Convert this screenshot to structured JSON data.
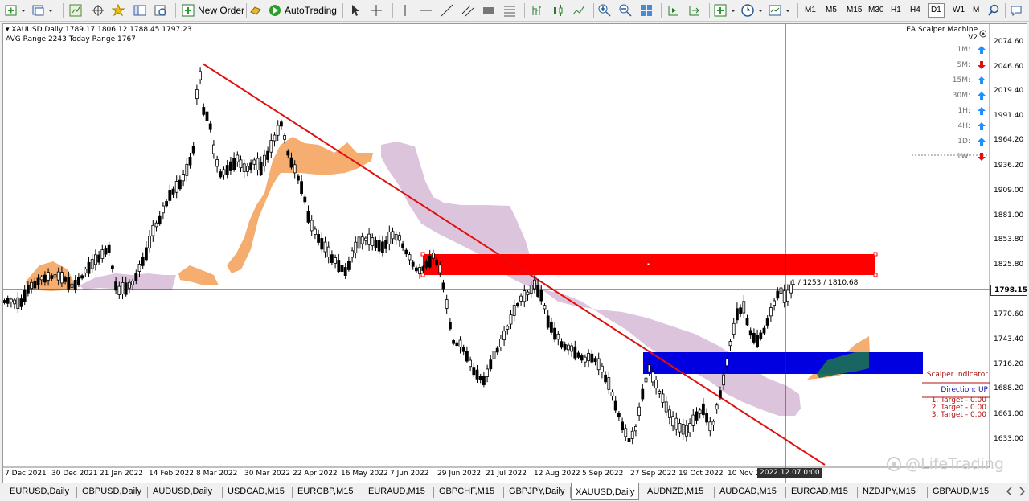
{
  "toolbar": {
    "new_order_label": "New Order",
    "autotrading_label": "AutoTrading",
    "timeframes": [
      "M1",
      "M5",
      "M15",
      "M30",
      "H1",
      "H4",
      "D1",
      "W1",
      "M"
    ],
    "active_timeframe": "D1"
  },
  "chart_header": {
    "symbol_line": "XAUUSD,Daily  1789.17 1806.12 1788.45 1797.23",
    "range_line": "AVG Range 2243   Today Range 1767"
  },
  "ea_panel": {
    "title": "EA Scalper Machine V2",
    "rows": [
      {
        "tf": "1M:",
        "dir": "up"
      },
      {
        "tf": "5M:",
        "dir": "down"
      },
      {
        "tf": "15M:",
        "dir": "up"
      },
      {
        "tf": "30M:",
        "dir": "up"
      },
      {
        "tf": "1H:",
        "dir": "up"
      },
      {
        "tf": "4H:",
        "dir": "up"
      },
      {
        "tf": "1D:",
        "dir": "up"
      },
      {
        "tf": "1W:",
        "dir": "down"
      }
    ]
  },
  "scalper_box": {
    "title": "Scalper Indicator",
    "direction": "Direction: UP",
    "targets": [
      "1. Target - 0.00",
      "2. Target - 0.00",
      "3. Target - 0.00"
    ]
  },
  "price_axis": {
    "ticks": [
      "2074.60",
      "2046.60",
      "2019.40",
      "1991.40",
      "1964.20",
      "1936.20",
      "1909.00",
      "1881.00",
      "1853.80",
      "1825.80",
      "1798.15",
      "1770.60",
      "1743.40",
      "1716.20",
      "1688.20",
      "1661.00",
      "1633.00"
    ],
    "current_price": "1798.15"
  },
  "time_axis": {
    "ticks": [
      "7 Dec 2021",
      "30 Dec 2021",
      "21 Jan 2022",
      "14 Feb 2022",
      "8 Mar 2022",
      "30 Mar 2022",
      "22 Apr 2022",
      "16 May 2022",
      "7 Jun 2022",
      "29 Jun 2022",
      "21 Jul 2022",
      "12 Aug 2022",
      "5 Sep 2022",
      "27 Sep 2022",
      "19 Oct 2022",
      "10 Nov 2"
    ],
    "crosshair_label": "2022.12.07 0:00"
  },
  "crosshair_readout": "1 / 1253 / 1810.68",
  "watermark": "@LifeTrading",
  "tabs": [
    "EURUSD,Daily",
    "GBPUSD,Daily",
    "AUDUSD,Daily",
    "USDCAD,M15",
    "EURGBP,M15",
    "EURAUD,M15",
    "GBPCHF,M15",
    "GBPJPY,Daily",
    "XAUUSD,Daily",
    "AUDNZD,M15",
    "AUDCAD,M15",
    "EURCAD,M15",
    "NZDJPY,M15",
    "GBPAUD,M15"
  ],
  "active_tab": "XAUUSD,Daily",
  "colors": {
    "trendline": "#e01010",
    "supply_zone": "#ff0000",
    "demand_zone": "#0000e0",
    "cloud_bull": "#f4a460",
    "cloud_bear": "#d8bfd8",
    "arrow_up": "#1e90ff",
    "arrow_down": "#e01010"
  }
}
